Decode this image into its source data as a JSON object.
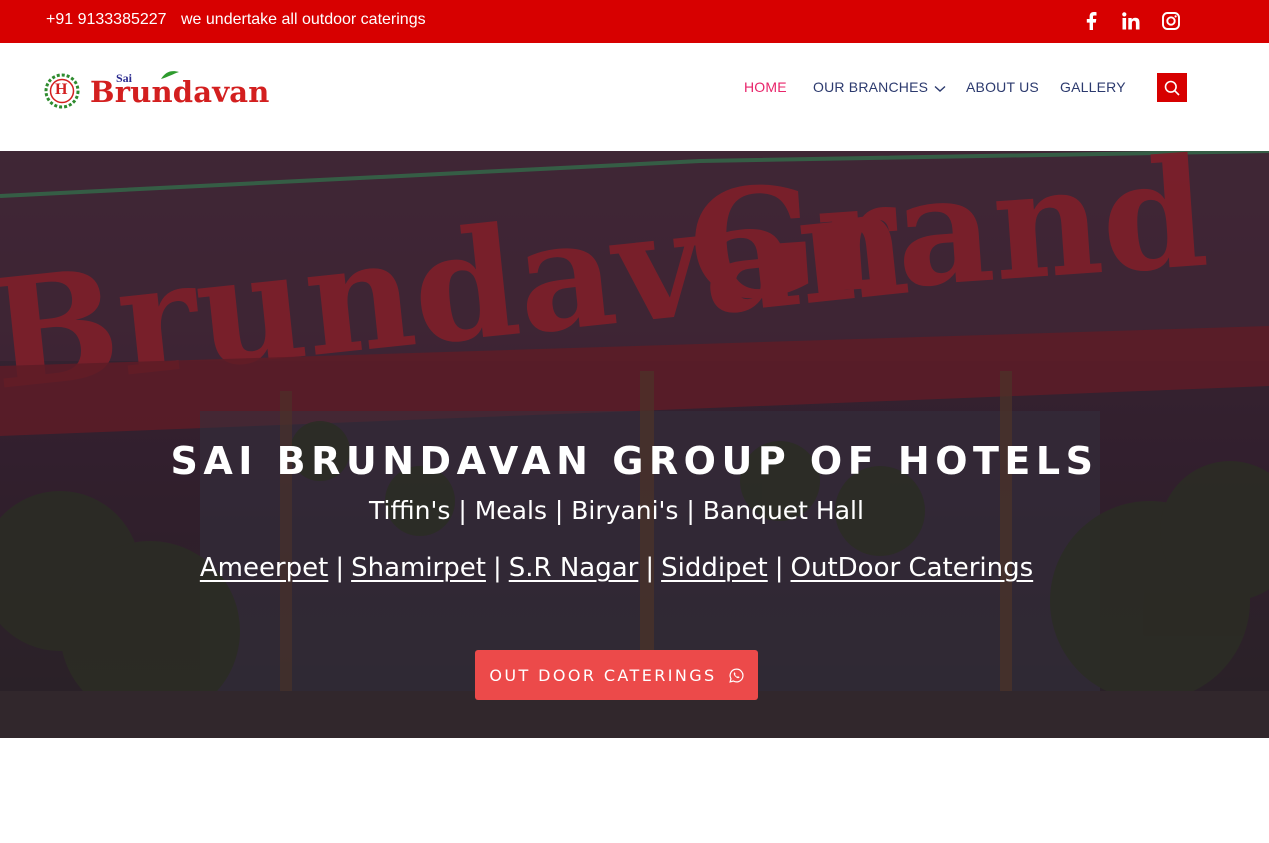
{
  "topbar": {
    "phone": "+91 9133385227",
    "tagline": "we undertake all outdoor caterings",
    "social_icons": [
      "facebook-icon",
      "linkedin-icon",
      "instagram-icon"
    ]
  },
  "logo": {
    "sai": "Sai",
    "brand": "Brundavan",
    "emblem_letter": "H"
  },
  "nav": {
    "items": [
      {
        "label": "HOME",
        "active": true
      },
      {
        "label": "OUR BRANCHES",
        "has_dropdown": true
      },
      {
        "label": "ABOUT US"
      },
      {
        "label": "GALLERY"
      }
    ],
    "search_icon": "search-icon"
  },
  "hero": {
    "title": "SAI BRUNDAVAN GROUP OF HOTELS",
    "subtitle": "Tiffin's | Meals | Biryani's | Banquet Hall",
    "links": [
      "Ameerpet",
      "Shamirpet",
      "S.R Nagar",
      "Siddipet",
      "OutDoor Caterings"
    ],
    "separator": "|",
    "cta_label": "OUT DOOR CATERINGS",
    "cta_icon": "whatsapp-icon"
  },
  "colors": {
    "topbar": "#d70000",
    "nav_text": "#2c3a6e",
    "nav_active": "#e8246a",
    "cta": "#ec4a4a",
    "brand_red": "#d31f1f"
  }
}
